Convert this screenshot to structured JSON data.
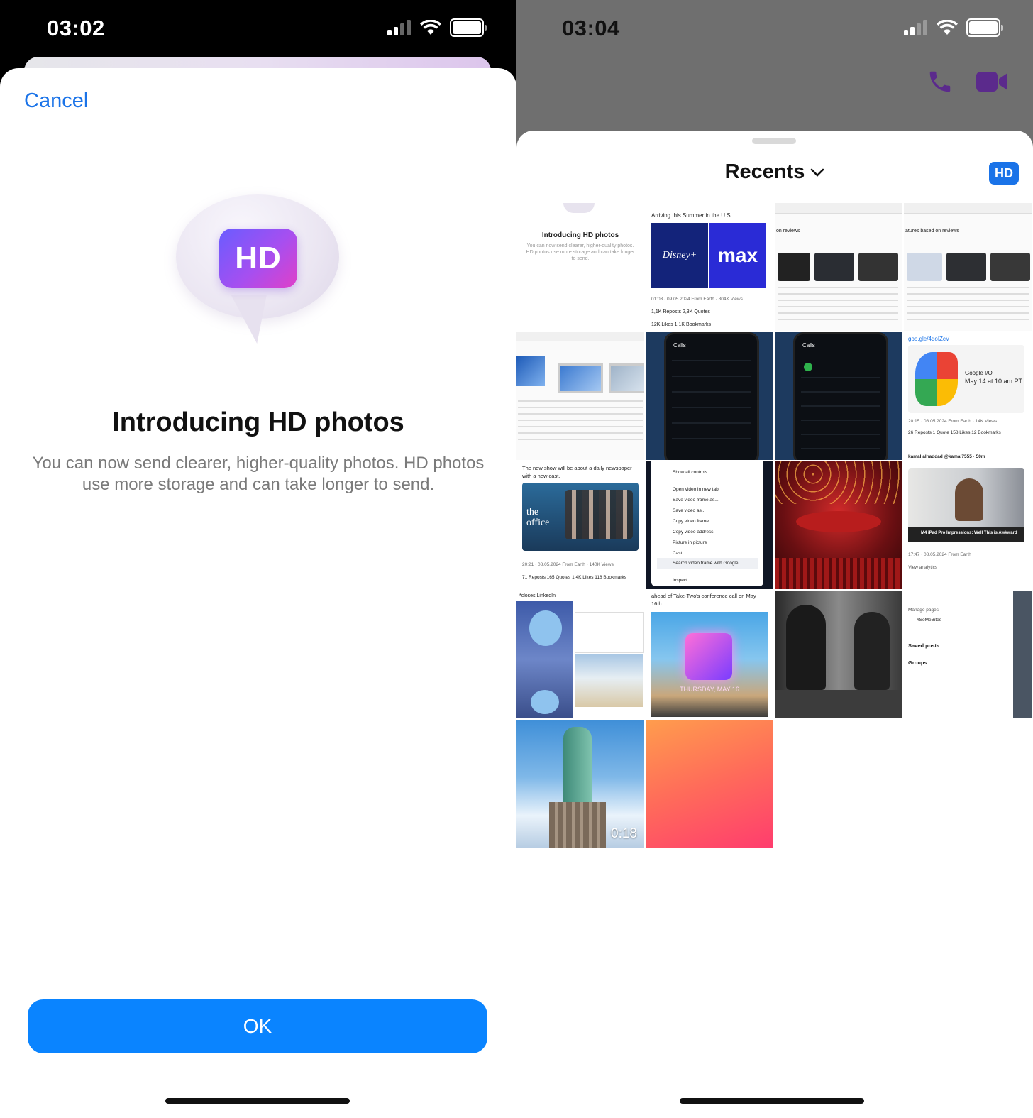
{
  "left": {
    "status": {
      "time": "03:02"
    },
    "cancel_label": "Cancel",
    "badge_label": "HD",
    "title": "Introducing HD photos",
    "body": "You can now send clearer, higher-quality photos. HD photos use more storage and can take longer to send.",
    "ok_label": "OK"
  },
  "right": {
    "status": {
      "time": "03:04"
    },
    "picker": {
      "title": "Recents",
      "hd_label": "HD"
    },
    "tiles": {
      "t1_title": "Introducing HD photos",
      "t1_body": "You can now send clearer, higher-quality photos. HD photos use more storage and can take longer to send.",
      "t2_caption": "Arriving this Summer in the U.S.",
      "t2_brand_a": "Disney+",
      "t2_brand_b": "max",
      "t2_meta": "01:03 · 09.05.2024 From Earth · 804K Views",
      "t2_stats": "1,1K Reposts  2,3K Quotes",
      "t2_stats2": "12K Likes  1,1K Bookmarks",
      "t3_caption": "on reviews",
      "t3_caption2": "atures based on reviews",
      "t5_title": "Calls",
      "t6_title": "Calls",
      "t7_link": "goo.gle/4doIZcV",
      "t7_event": "Google I/O",
      "t7_date": "May 14 at 10 am PT",
      "t7_meta": "20:15 · 08.05.2024 From Earth · 14K Views",
      "t7_stats": "26 Reposts  1 Quote  158 Likes  12 Bookmarks",
      "t7_user": "kamal alhaddad @kamal7555 · 50m",
      "t8_caption": "The new show will be about a daily newspaper with a new cast.",
      "t8_show": "the office",
      "t8_meta": "20:21 · 08.05.2024 From Earth · 140K Views",
      "t8_stats": "71 Reposts  165 Quotes  1,4K Likes  118 Bookmarks",
      "t9_menu": [
        "Show all controls",
        "Open video in new tab",
        "Save video frame as...",
        "Save video as...",
        "Copy video frame",
        "Copy video address",
        "Picture in picture",
        "Cast...",
        "Search video frame with Google",
        "Inspect"
      ],
      "t11_video": "M4 iPad Pro Impressions: Well This is Awkward",
      "t11_meta": "17:47 · 08.05.2024 From Earth",
      "t11_analytics": "View analytics",
      "t12_caption": "*closes LinkedIn",
      "t13_caption": "ahead of Take-Two's conference call on May 16th.",
      "t13_date": "THURSDAY, MAY 16",
      "t15_manage": "Manage pages",
      "t15_page": "#SoMeBites",
      "t15_saved": "Saved posts",
      "t15_groups": "Groups",
      "t16_duration": "0:18"
    }
  },
  "colors": {
    "accent": "#0a84ff",
    "link": "#1a73e8",
    "call_icons": "#5b2a8c"
  },
  "icons": [
    "signal-icon",
    "wifi-icon",
    "battery-icon",
    "phone-icon",
    "video-icon",
    "chevron-down-icon"
  ]
}
